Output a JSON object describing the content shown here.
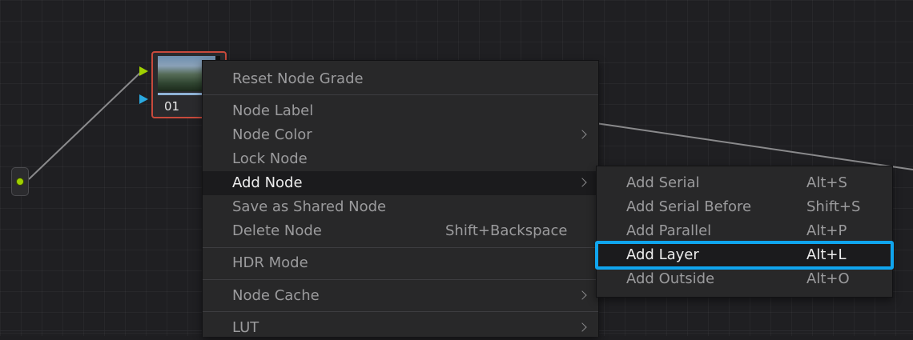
{
  "node": {
    "label": "01"
  },
  "main_menu": {
    "items": [
      {
        "label": "Reset Node Grade"
      },
      {
        "label": "Node Label"
      },
      {
        "label": "Node Color"
      },
      {
        "label": "Lock Node"
      },
      {
        "label": "Add Node"
      },
      {
        "label": "Save as Shared Node"
      },
      {
        "label": "Delete Node",
        "shortcut": "Shift+Backspace"
      },
      {
        "label": "HDR Mode"
      },
      {
        "label": "Node Cache"
      },
      {
        "label": "LUT"
      }
    ]
  },
  "sub_menu": {
    "items": [
      {
        "label": "Add Serial",
        "shortcut": "Alt+S"
      },
      {
        "label": "Add Serial Before",
        "shortcut": "Shift+S"
      },
      {
        "label": "Add Parallel",
        "shortcut": "Alt+P"
      },
      {
        "label": "Add Layer",
        "shortcut": "Alt+L"
      },
      {
        "label": "Add Outside",
        "shortcut": "Alt+O"
      }
    ]
  },
  "colors": {
    "node_border": "#c84a3c",
    "highlight": "#10a5ee",
    "rgb_input": "#9fd000",
    "key_input": "#2aa9e0"
  }
}
